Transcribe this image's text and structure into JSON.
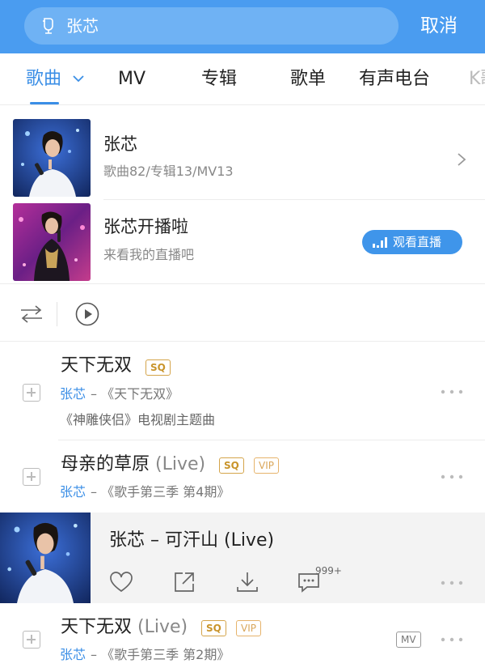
{
  "search": {
    "query": "张芯",
    "cancel_label": "取消"
  },
  "tabs": [
    {
      "label": "歌曲"
    },
    {
      "label": "MV"
    },
    {
      "label": "专辑"
    },
    {
      "label": "歌单"
    },
    {
      "label": "有声电台"
    },
    {
      "label": "K歌"
    }
  ],
  "artist": {
    "name": "张芯",
    "stats": "歌曲82/专辑13/MV13"
  },
  "live": {
    "title": "张芯开播啦",
    "subtitle": "来看我的直播吧",
    "button_label": "观看直播"
  },
  "songs": [
    {
      "title": "天下无双",
      "badges": [
        "SQ"
      ],
      "artist": "张芯",
      "album": " – 《天下无双》",
      "desc": "《神雕侠侣》电视剧主题曲"
    },
    {
      "title": "母亲的草原",
      "title_suffix": "(Live)",
      "badges": [
        "SQ",
        "VIP"
      ],
      "artist": "张芯",
      "album": " – 《歌手第三季 第4期》"
    },
    {
      "title": "天下无双",
      "title_suffix": "(Live)",
      "badges": [
        "SQ",
        "VIP"
      ],
      "mv_badge": "MV",
      "artist": "张芯",
      "album": " – 《歌手第三季 第2期》"
    }
  ],
  "now_playing": {
    "title": "张芯 – 可汗山 (Live)",
    "comment_count": "999+"
  },
  "colors": {
    "header_blue": "#4a9cf0",
    "accent_blue": "#3a8ee6",
    "sq_gold": "#c9942b"
  }
}
